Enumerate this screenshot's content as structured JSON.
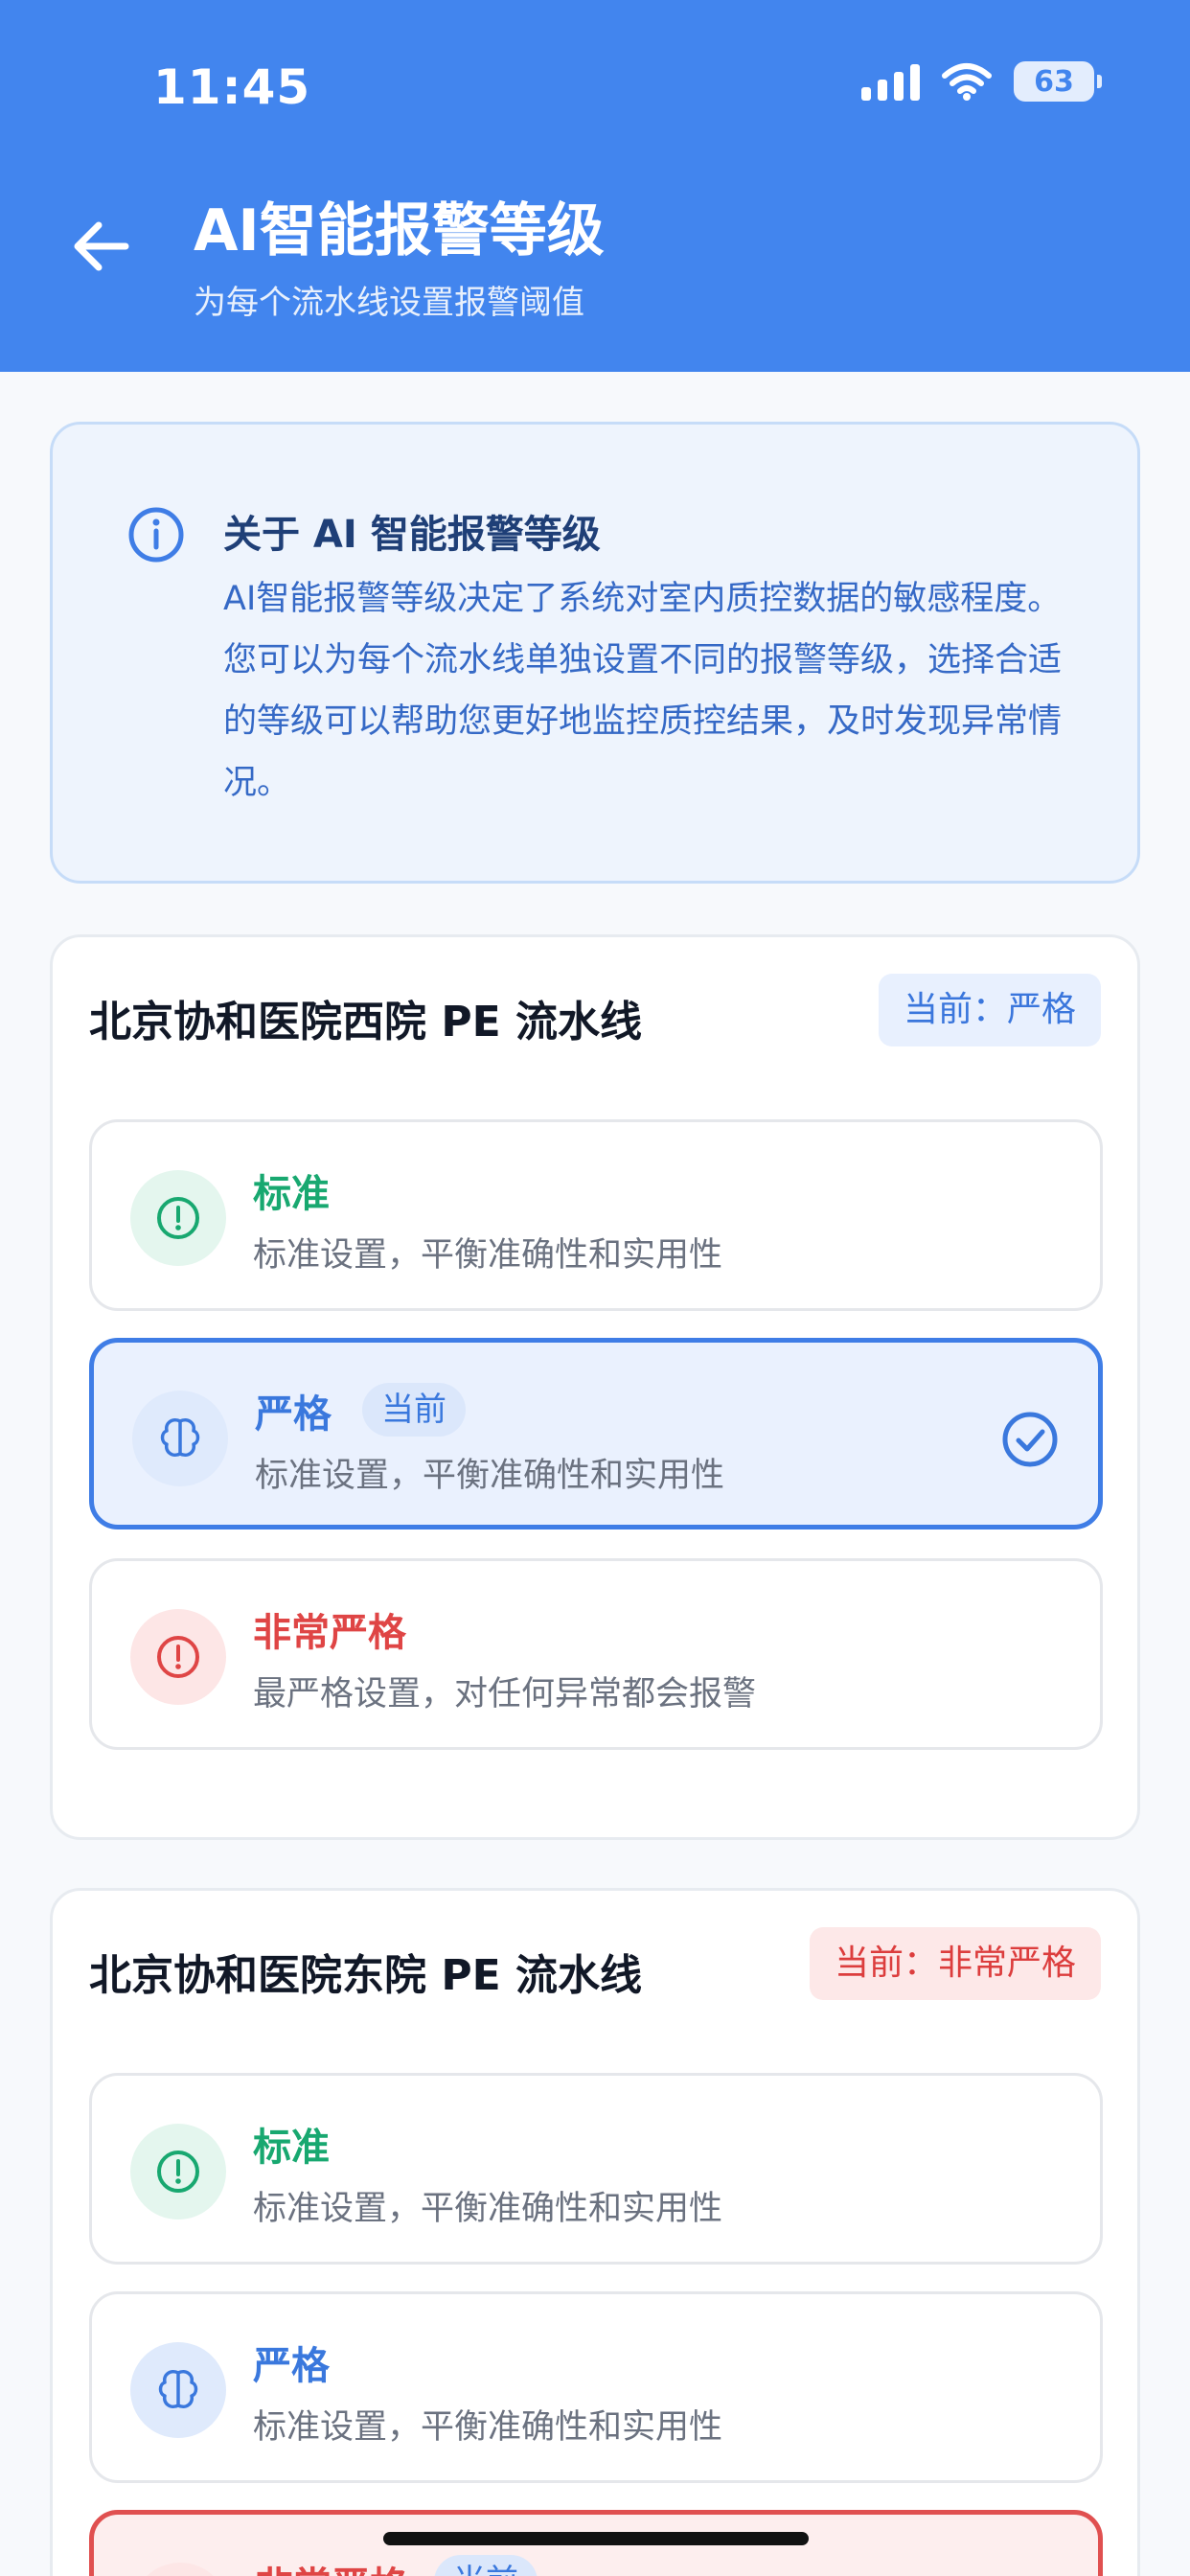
{
  "status": {
    "time": "11:45",
    "battery": "63"
  },
  "header": {
    "title": "AI智能报警等级",
    "subtitle": "为每个流水线设置报警阈值"
  },
  "info": {
    "title": "关于 AI 智能报警等级",
    "text": "AI智能报警等级决定了系统对室内质控数据的敏感程度。您可以为每个流水线单独设置不同的报警等级，选择合适的等级可以帮助您更好地监控质控结果，及时发现异常情况。"
  },
  "lines": [
    {
      "name": "北京协和医院西院 PE 流水线",
      "current": "当前：严格",
      "options": [
        {
          "name": "标准",
          "desc": "标准设置，平衡准确性和实用性"
        },
        {
          "name": "严格",
          "tag": "当前",
          "desc": "标准设置，平衡准确性和实用性"
        },
        {
          "name": "非常严格",
          "desc": "最严格设置，对任何异常都会报警"
        }
      ]
    },
    {
      "name": "北京协和医院东院 PE 流水线",
      "current": "当前：非常严格",
      "options": [
        {
          "name": "标准",
          "desc": "标准设置，平衡准确性和实用性"
        },
        {
          "name": "严格",
          "desc": "标准设置，平衡准确性和实用性"
        },
        {
          "name": "非常严格",
          "tag": "当前"
        }
      ]
    }
  ],
  "colors": {
    "primary": "#4285ee",
    "green": "#18a870",
    "blue": "#3a78dd",
    "red": "#df4545"
  }
}
